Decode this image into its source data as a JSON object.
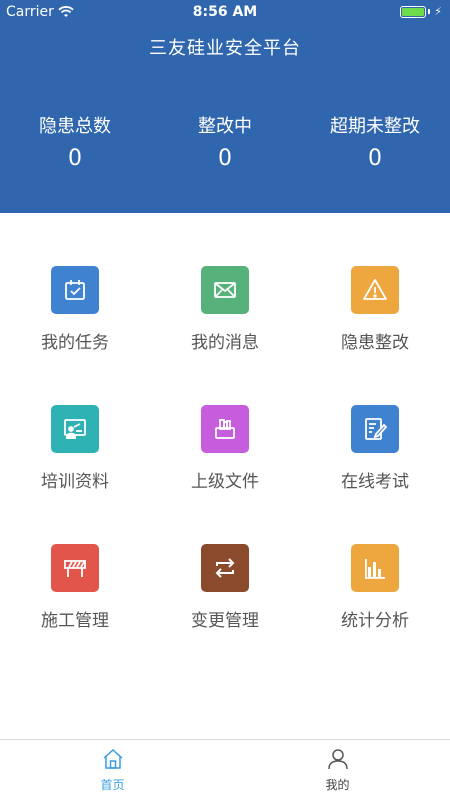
{
  "status_bar": {
    "carrier": "Carrier",
    "time": "8:56 AM"
  },
  "header": {
    "title": "三友硅业安全平台"
  },
  "stats": [
    {
      "label": "隐患总数",
      "value": "0"
    },
    {
      "label": "整改中",
      "value": "0"
    },
    {
      "label": "超期未整改",
      "value": "0"
    }
  ],
  "menu": [
    {
      "label": "我的任务",
      "icon": "calendar-check-icon",
      "color": "#3f82cf"
    },
    {
      "label": "我的消息",
      "icon": "envelope-icon",
      "color": "#56b27a"
    },
    {
      "label": "隐患整改",
      "icon": "warning-icon",
      "color": "#eea63f"
    },
    {
      "label": "培训资料",
      "icon": "presentation-icon",
      "color": "#2fb2b4"
    },
    {
      "label": "上级文件",
      "icon": "folder-icon",
      "color": "#c65ddc"
    },
    {
      "label": "在线考试",
      "icon": "exam-edit-icon",
      "color": "#3f82cf"
    },
    {
      "label": "施工管理",
      "icon": "barrier-icon",
      "color": "#e2554a"
    },
    {
      "label": "变更管理",
      "icon": "swap-icon",
      "color": "#8b4a2c"
    },
    {
      "label": "统计分析",
      "icon": "bar-chart-icon",
      "color": "#eea63f"
    }
  ],
  "tabbar": {
    "tabs": [
      {
        "label": "首页",
        "icon": "home-icon",
        "active": true
      },
      {
        "label": "我的",
        "icon": "user-icon",
        "active": false
      }
    ],
    "active_color": "#3a9de0"
  }
}
